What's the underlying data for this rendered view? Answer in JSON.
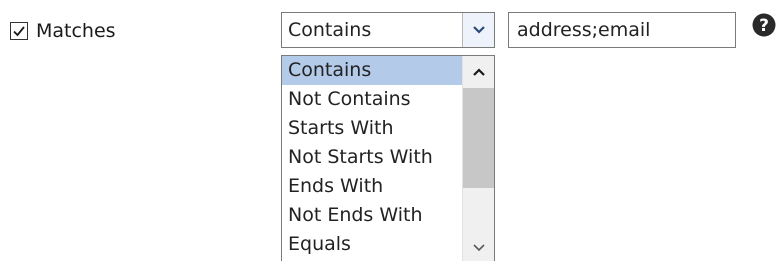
{
  "filter": {
    "checkbox_label": "Matches",
    "checked": true,
    "operator_value": "Contains",
    "text_value": "address;email"
  },
  "dropdown": {
    "options": [
      "Contains",
      "Not Contains",
      "Starts With",
      "Not Starts With",
      "Ends With",
      "Not Ends With",
      "Equals"
    ],
    "selected": "Contains"
  },
  "icons": {
    "checkbox": "checkmark-icon",
    "combo_arrow": "chevron-down-icon",
    "help": "question-circle-icon",
    "scroll_up": "chevron-up-icon",
    "scroll_down": "chevron-down-icon"
  },
  "colors": {
    "selection": "#b3cbe9",
    "combo_arrow_bg": "#eef3fb",
    "scroll_thumb": "#c7c7c7"
  }
}
